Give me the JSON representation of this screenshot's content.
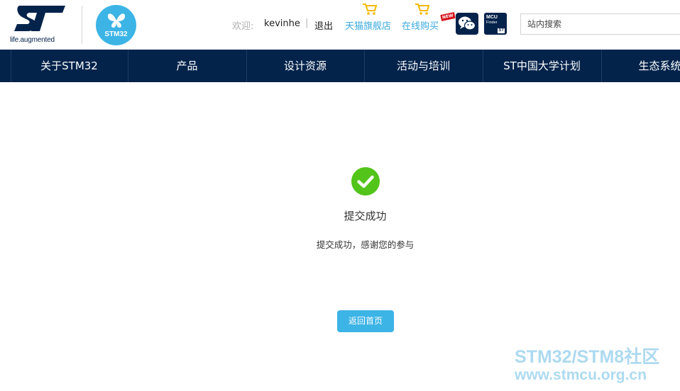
{
  "header": {
    "brand_tagline": "life.augmented",
    "badge_text": "STM32",
    "welcome_label": "欢迎:",
    "username": "kevinhe",
    "separator": "|",
    "logout_label": "退出",
    "tmall_label": "天猫旗舰店",
    "buy_online_label": "在线购买",
    "new_tag": "NEW",
    "mcu_finder_line1": "MCU",
    "mcu_finder_line2": "Finder",
    "mcu_finder_st": "ST",
    "search_placeholder": "站内搜索"
  },
  "nav": {
    "items": [
      {
        "label": "关于STM32"
      },
      {
        "label": "产品"
      },
      {
        "label": "设计资源"
      },
      {
        "label": "活动与培训"
      },
      {
        "label": "ST中国大学计划"
      },
      {
        "label": "生态系统"
      }
    ]
  },
  "result": {
    "title": "提交成功",
    "message": "提交成功，感谢您的参与",
    "home_button": "返回首页"
  },
  "watermark": {
    "line1": "STM32/STM8社区",
    "line2": "www.stmcu.org.cn"
  },
  "colors": {
    "nav_bg": "#03234b",
    "accent": "#3cb4e6",
    "success": "#52c41a",
    "link": "#38a9dd"
  }
}
